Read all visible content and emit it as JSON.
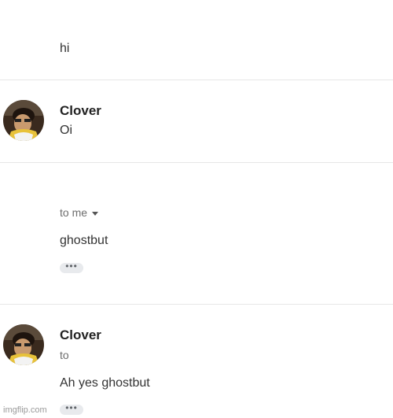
{
  "messages": [
    {
      "body": "hi"
    },
    {
      "sender": "Clover",
      "body": "Oi"
    },
    {
      "recipient_label": "to me",
      "body": "ghostbut",
      "more_label": "•••"
    },
    {
      "sender": "Clover",
      "recipient_label": "to",
      "body": "Ah yes ghostbut",
      "more_label": "•••"
    }
  ],
  "watermark": "imgflip.com",
  "icons": {
    "caret": "chevron-down-icon",
    "avatar": "profile-photo"
  }
}
